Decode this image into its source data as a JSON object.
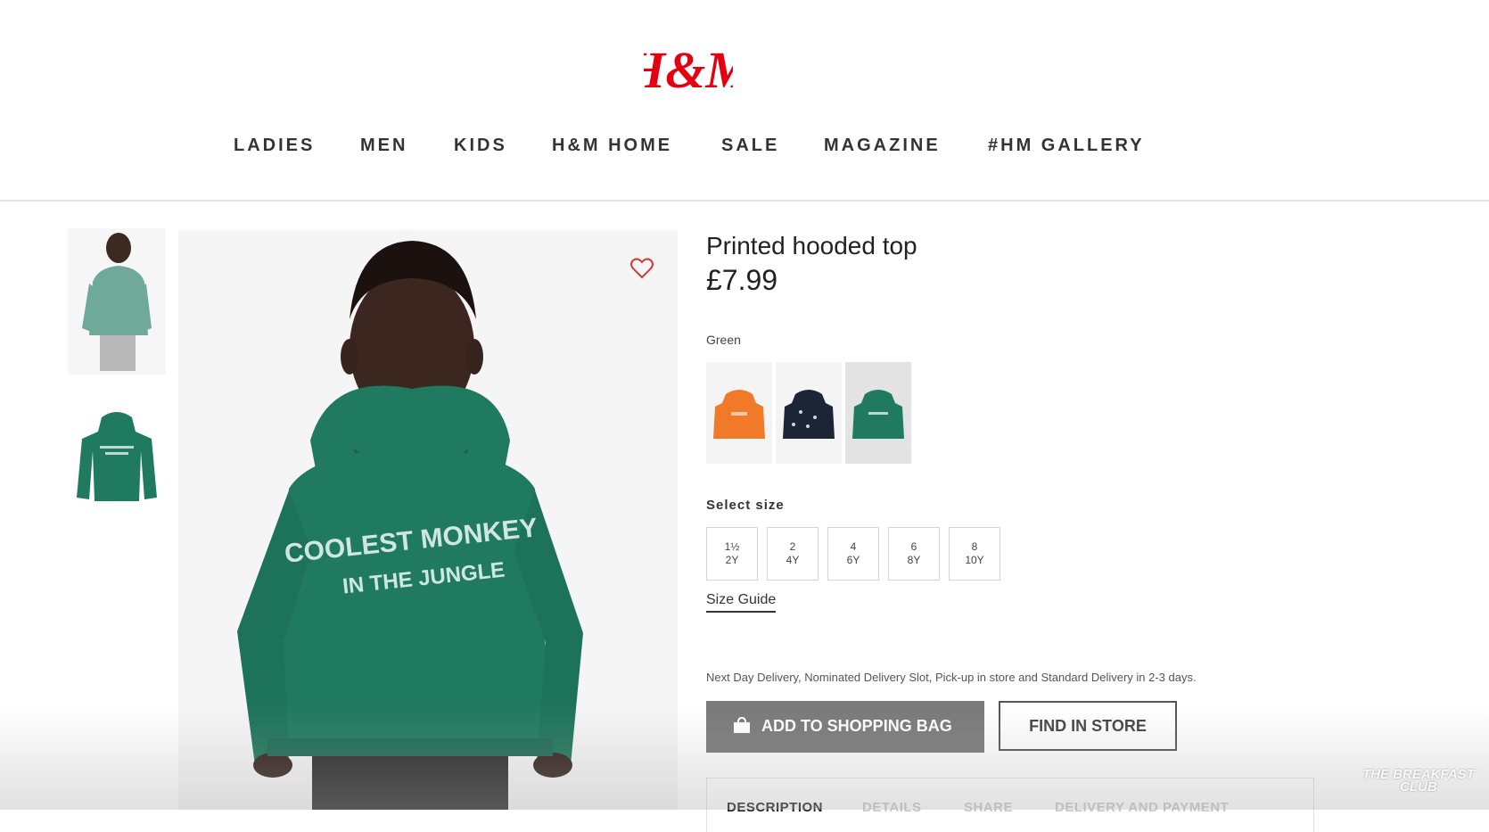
{
  "brand": {
    "logo_text": "H&M",
    "color": "#e50010"
  },
  "nav": {
    "items": [
      "LADIES",
      "MEN",
      "KIDS",
      "H&M HOME",
      "SALE",
      "MAGAZINE",
      "#HM GALLERY"
    ]
  },
  "gallery": {
    "thumbnail_count": 2
  },
  "product": {
    "title": "Printed hooded top",
    "price": "£7.99",
    "color_label": "Green",
    "hoodie_print": [
      "COOLEST MONKEY",
      "IN THE JUNGLE"
    ],
    "swatches": [
      {
        "name": "orange",
        "color": "#f07a2a",
        "selected": false
      },
      {
        "name": "navy",
        "color": "#1c2536",
        "selected": false
      },
      {
        "name": "green",
        "color": "#1f7a5f",
        "selected": true
      }
    ]
  },
  "size": {
    "label": "Select size",
    "options": [
      {
        "line1": "1½",
        "line2": "2Y"
      },
      {
        "line1": "2",
        "line2": "4Y"
      },
      {
        "line1": "4",
        "line2": "6Y"
      },
      {
        "line1": "6",
        "line2": "8Y"
      },
      {
        "line1": "8",
        "line2": "10Y"
      }
    ],
    "guide_label": "Size Guide"
  },
  "delivery_text": "Next Day Delivery, Nominated Delivery Slot, Pick-up in store and Standard Delivery in 2-3 days.",
  "actions": {
    "add_to_bag": "ADD TO SHOPPING BAG",
    "find_in_store": "FIND IN STORE"
  },
  "tabs": [
    "DESCRIPTION",
    "DETAILS",
    "SHARE",
    "DELIVERY AND PAYMENT"
  ],
  "watermark": {
    "line1": "THE BREAKFAST",
    "line2": "CLUB"
  },
  "colors": {
    "hoodie": "#1f7a5f",
    "add_button": "#7a7a7a"
  }
}
